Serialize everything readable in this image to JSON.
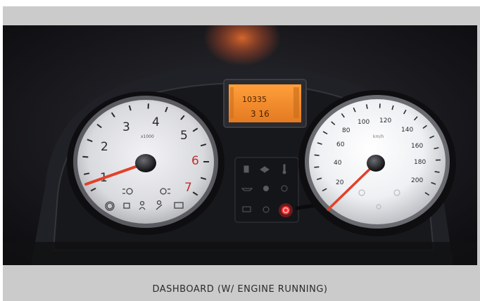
{
  "caption": "DASHBOARD (W/ ENGINE RUNNING)",
  "tachometer": {
    "numbers": [
      "1",
      "2",
      "3",
      "4",
      "5",
      "6",
      "7"
    ],
    "unit_label": "x1000"
  },
  "speedometer": {
    "numbers": [
      "20",
      "40",
      "60",
      "80",
      "100",
      "120",
      "140",
      "160",
      "180",
      "200"
    ],
    "unit_label": "km/h"
  },
  "lcd": {
    "line1": "10335",
    "line2": "3 16"
  },
  "colors": {
    "frame": "#cbcbcb",
    "dashboard": "#1b1c20",
    "dial_face": "#e9e9ee",
    "needle": "#e2412a",
    "redline": "#c0302a",
    "lcd": "#f08a2a",
    "warning_light": "#ff2a2a"
  },
  "icons": [
    "headlight-icon",
    "fog-light-icon",
    "fuel-icon",
    "parking-light-icon",
    "high-beam-icon",
    "hazard-icon",
    "temperature-icon",
    "oil-icon",
    "battery-icon",
    "seatbelt-icon",
    "power-icon"
  ]
}
